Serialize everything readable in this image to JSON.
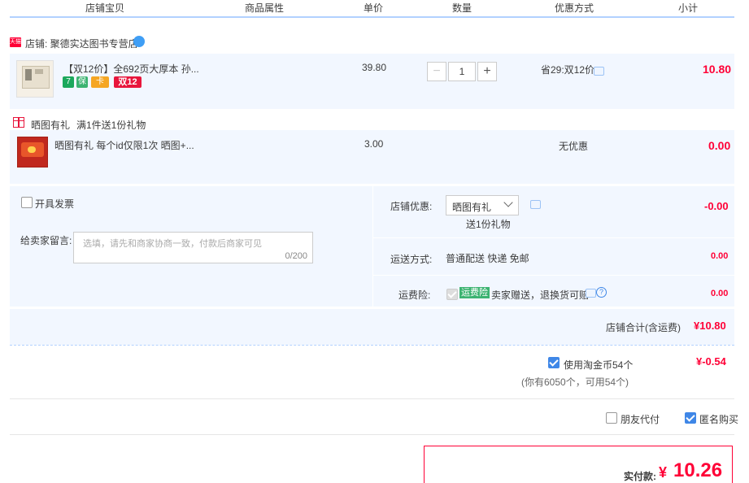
{
  "header": {
    "col_item": "店铺宝贝",
    "col_attr": "商品属性",
    "col_price": "单价",
    "col_qty": "数量",
    "col_discount": "优惠方式",
    "col_subtotal": "小计"
  },
  "shop": {
    "tag": "天猫",
    "name": "店铺: 聚德实达图书专营店",
    "chat_icon": "wangwang-icon"
  },
  "item1": {
    "title": "【双12价】全692页大厚本 孙...",
    "badges": [
      "7",
      "保",
      "卡",
      "双12"
    ],
    "price": "39.80",
    "qty": "1",
    "qty_minus": "−",
    "qty_plus": "+",
    "discount": "省29:双12价",
    "subtotal": "10.80"
  },
  "gift": {
    "title": "晒图有礼",
    "desc": "满1件送1份礼物"
  },
  "item2": {
    "title": "晒图有礼 每个id仅限1次 晒图+...",
    "price": "3.00",
    "discount": "无优惠",
    "subtotal": "0.00"
  },
  "options": {
    "invoice_label": "开具发票",
    "message_label": "给卖家留言:",
    "message_placeholder": "选填，请先和商家协商一致，付款后商家可见",
    "message_count": "0/200",
    "shop_discount_label": "店铺优惠:",
    "shop_discount_value": "晒图有礼",
    "shop_discount_note": "送1份礼物",
    "shop_discount_amount": "-0.00",
    "shipping_label": "运送方式:",
    "shipping_value": "普通配送 快递 免邮",
    "shipping_amount": "0.00",
    "insurance_label": "运费险:",
    "insurance_tag": "运费险",
    "insurance_desc": "卖家赠送，退换货可赔",
    "insurance_amount": "0.00"
  },
  "shop_total": {
    "label": "店铺合计(含运费)",
    "amount": "¥10.80"
  },
  "coins": {
    "label": "使用淘金币54个",
    "amount": "¥-0.54",
    "note": "(你有6050个，可用54个)"
  },
  "extra": {
    "friend_pay": "朋友代付",
    "anonymous": "匿名购买"
  },
  "pay": {
    "label": "实付款:",
    "currency": "¥",
    "amount": "10.26"
  },
  "colors": {
    "accent_blue": "#3f87e7",
    "price_red": "#ff0036",
    "band_blue": "#f2f7ff"
  }
}
